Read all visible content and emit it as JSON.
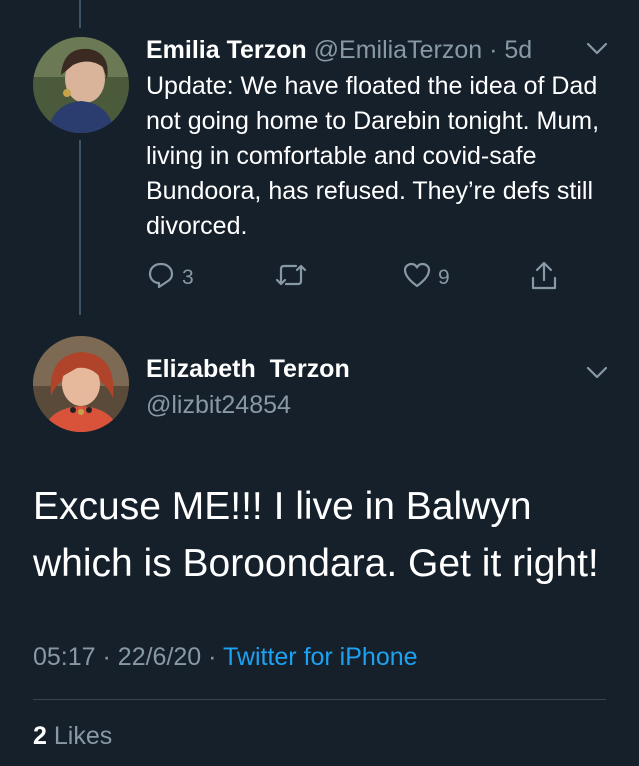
{
  "reply_to_tweet": {
    "author_name": "Emilia Terzon",
    "author_handle": "@EmiliaTerzon",
    "separator": "·",
    "time_ago": "5d",
    "text": "Update: We have floated the idea of Dad not going home to Darebin tonight. Mum, living in comfortable and covid-safe Bundoora, has refused. They’re defs still divorced.",
    "reply_count": "3",
    "like_count": "9"
  },
  "main_tweet": {
    "author_name": "Elizabeth  Terzon",
    "author_handle": "@lizbit24854",
    "text": "Excuse ME!!! I live in Balwyn which is Boroondara. Get it right!",
    "time": "05:17",
    "date": "22/6/20",
    "separator": "·",
    "source": "Twitter for iPhone",
    "likes_count": "2",
    "likes_label": "Likes"
  },
  "colors": {
    "background": "#15202b",
    "muted": "#8899a6",
    "link": "#1da1f2",
    "divider": "#38444d"
  },
  "icons": [
    "reply-icon",
    "retweet-icon",
    "like-icon",
    "share-icon",
    "chevron-down-icon"
  ]
}
